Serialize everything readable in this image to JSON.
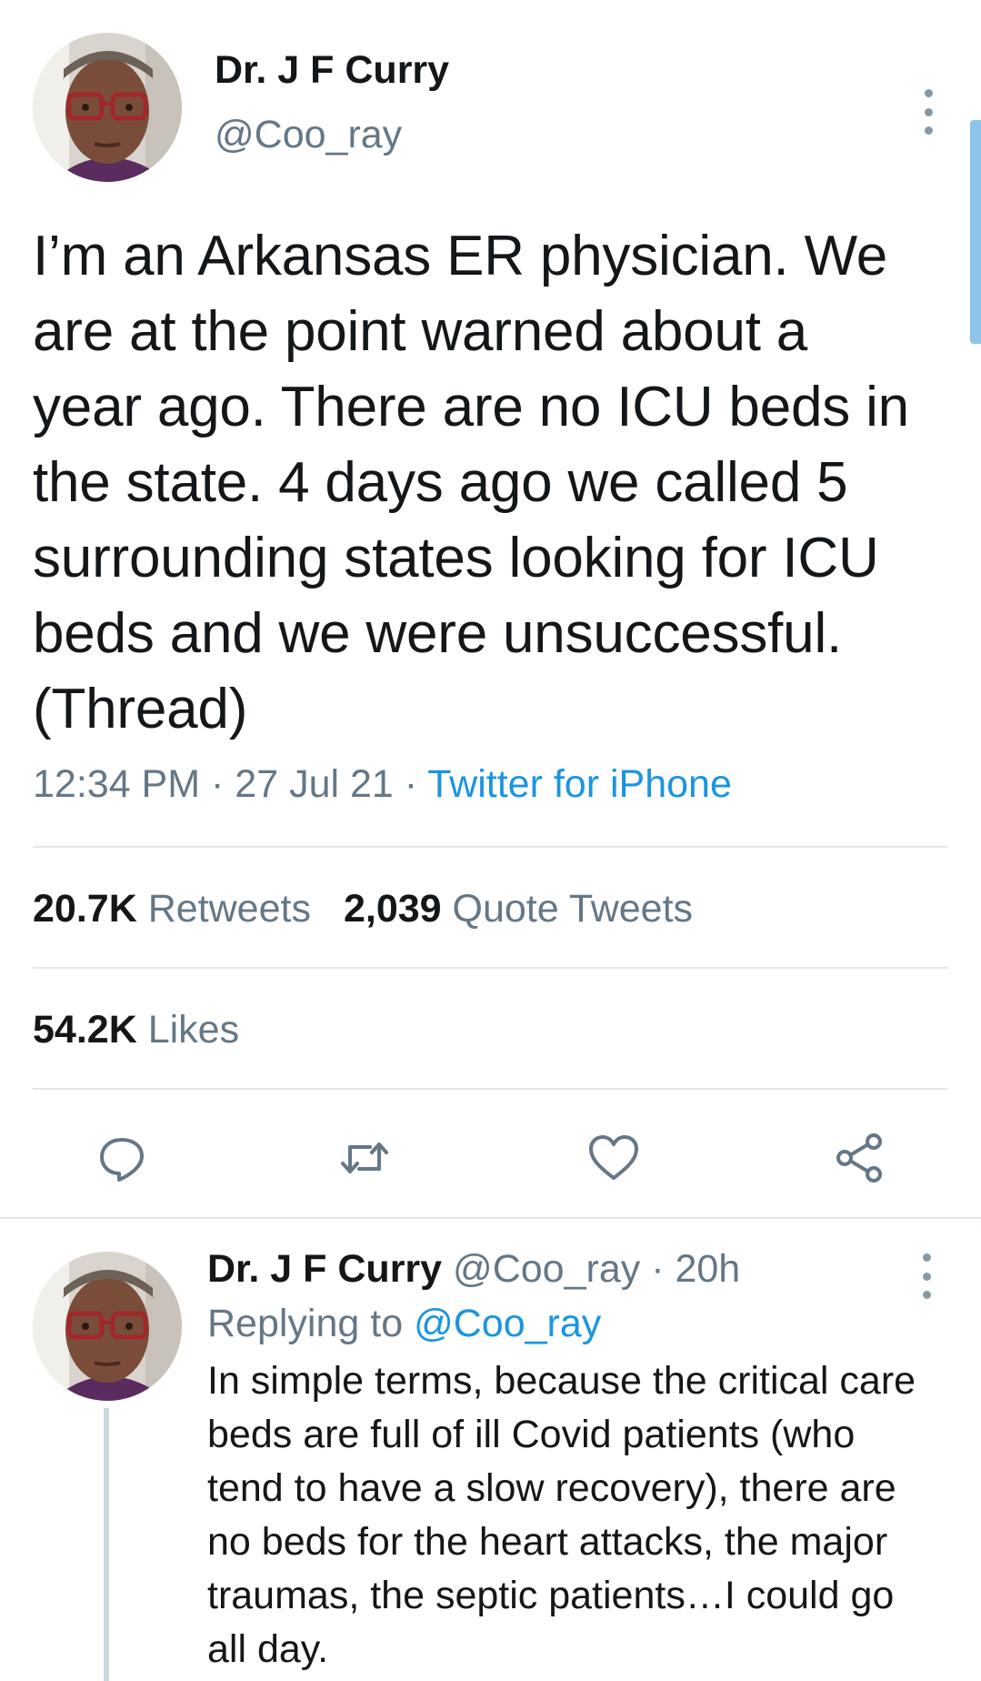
{
  "main_tweet": {
    "author": {
      "display_name": "Dr. J F Curry",
      "handle": "@Coo_ray"
    },
    "text": "I’m an Arkansas ER physician.  We\nare at the point warned about a\nyear ago. There are no ICU beds in\nthe state. 4 days ago we called 5\nsurrounding states looking for ICU\nbeds and we were unsuccessful.\n(Thread)",
    "time": "12:34 PM",
    "date": "27 Jul 21",
    "separator": "·",
    "source": "Twitter for iPhone",
    "stats": {
      "retweets_count": "20.7K",
      "retweets_label": "Retweets",
      "quotes_count": "2,039",
      "quotes_label": "Quote Tweets",
      "likes_count": "54.2K",
      "likes_label": "Likes"
    },
    "actions": [
      {
        "icon": "reply-icon"
      },
      {
        "icon": "retweet-icon"
      },
      {
        "icon": "like-icon"
      },
      {
        "icon": "share-icon"
      }
    ]
  },
  "reply_tweet": {
    "author": {
      "display_name": "Dr. J F Curry",
      "handle": "@Coo_ray"
    },
    "separator": "·",
    "age": "20h",
    "replying_prefix": "Replying to",
    "replying_to": "@Coo_ray",
    "text": "In simple terms, because the critical care\nbeds are full of ill Covid patients (who\ntend to have a slow recovery), there are\nno beds for the heart attacks, the major\ntraumas, the septic patients…I could go\nall day."
  },
  "colors": {
    "text": "#14171a",
    "muted": "#657786",
    "link": "#1b95e0",
    "divider": "#e1e8ed",
    "scroll_indicator": "#8ec3ea"
  }
}
